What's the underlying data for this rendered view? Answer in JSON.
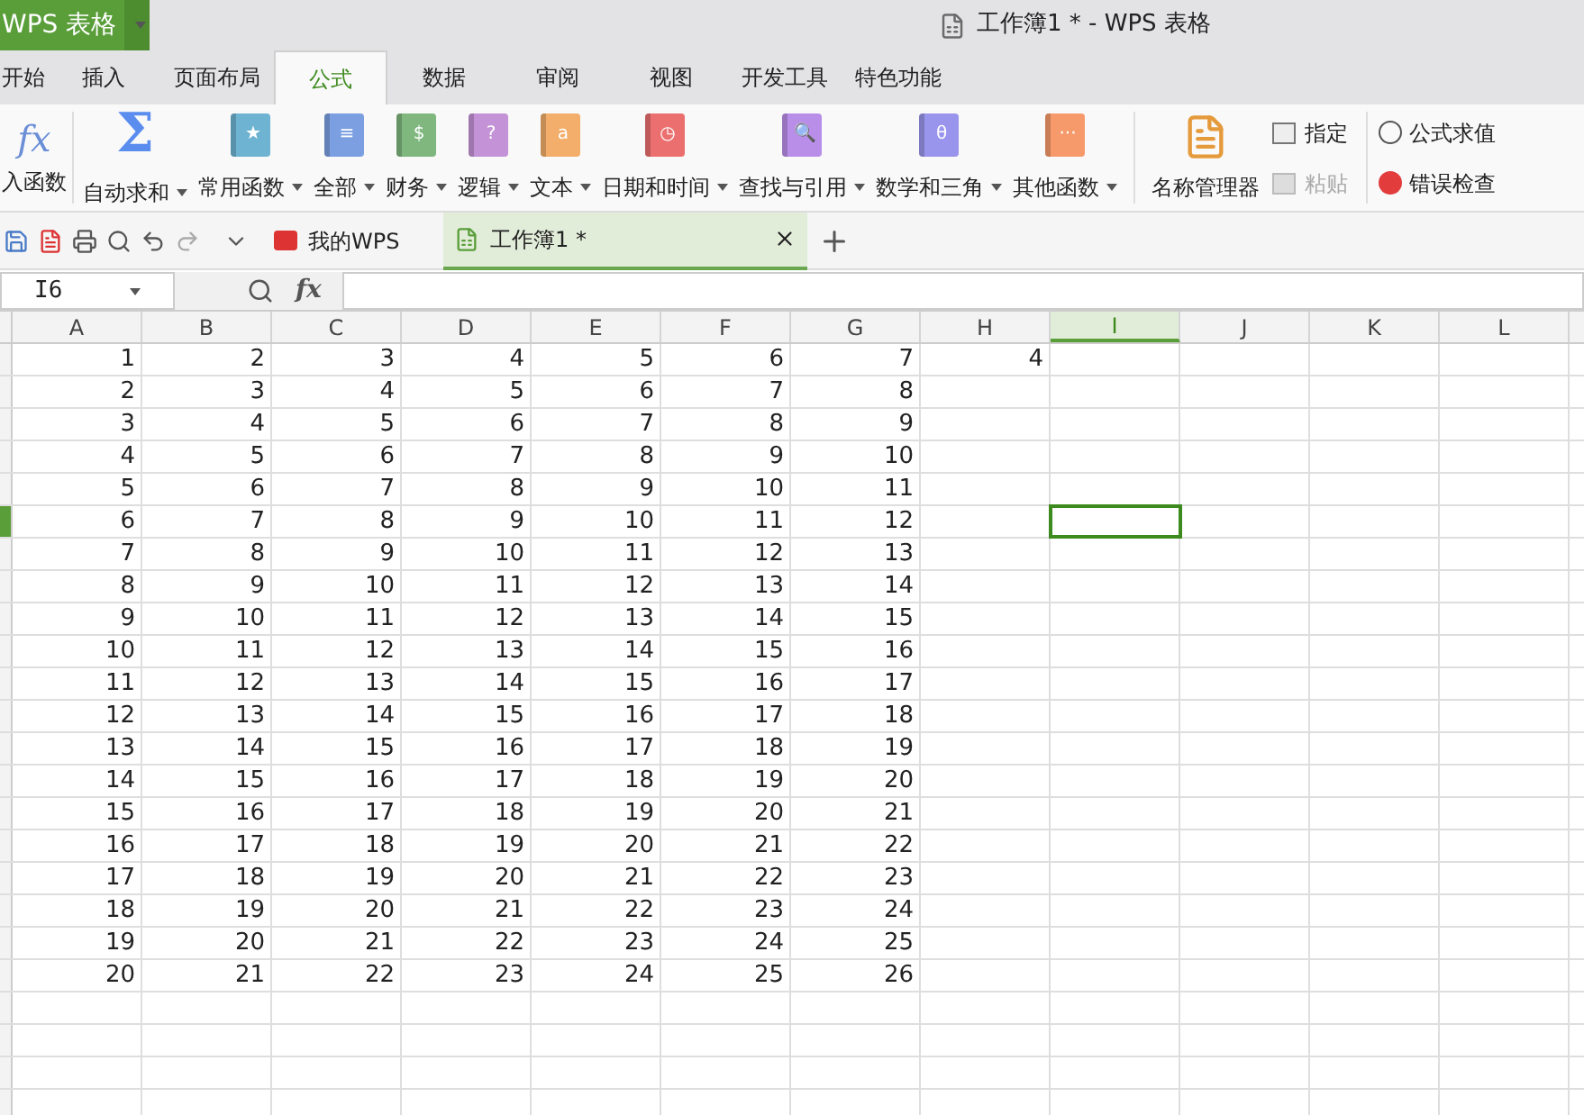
{
  "app_button": {
    "label": "WPS 表格"
  },
  "window": {
    "title": "工作簿1 * - WPS 表格"
  },
  "menu_tabs": [
    {
      "label": "开始",
      "selected": false
    },
    {
      "label": "插入",
      "selected": false
    },
    {
      "label": "页面布局",
      "selected": false
    },
    {
      "label": "公式",
      "selected": true
    },
    {
      "label": "数据",
      "selected": false
    },
    {
      "label": "审阅",
      "selected": false
    },
    {
      "label": "视图",
      "selected": false
    },
    {
      "label": "开发工具",
      "selected": false
    },
    {
      "label": "特色功能",
      "selected": false
    }
  ],
  "ribbon": {
    "insert_function": {
      "icon_text": "fx",
      "label": "入函数"
    },
    "function_groups": [
      {
        "label": "自动求和",
        "kind": "sigma",
        "color": "#5b8def",
        "glyph": "Σ"
      },
      {
        "label": "常用函数",
        "kind": "book",
        "color": "#6fb3d2",
        "glyph": "★"
      },
      {
        "label": "全部",
        "kind": "book",
        "color": "#7b9fe0",
        "glyph": "≡"
      },
      {
        "label": "财务",
        "kind": "book",
        "color": "#7fb77e",
        "glyph": "$"
      },
      {
        "label": "逻辑",
        "kind": "book",
        "color": "#c492d6",
        "glyph": "?"
      },
      {
        "label": "文本",
        "kind": "book",
        "color": "#f2ae6a",
        "glyph": "a"
      },
      {
        "label": "日期和时间",
        "kind": "book",
        "color": "#ec6f6f",
        "glyph": "◷"
      },
      {
        "label": "查找与引用",
        "kind": "book",
        "color": "#b98ee8",
        "glyph": "🔍"
      },
      {
        "label": "数学和三角",
        "kind": "book",
        "color": "#9a95ec",
        "glyph": "θ"
      },
      {
        "label": "其他函数",
        "kind": "book",
        "color": "#f79a6b",
        "glyph": "···"
      }
    ],
    "name_manager": {
      "label": "名称管理器"
    },
    "small_buttons": [
      {
        "label": "指定",
        "disabled": false
      },
      {
        "label": "粘贴",
        "disabled": true
      }
    ],
    "audit_buttons": [
      {
        "label": "公式求值"
      },
      {
        "label": "错误检查"
      }
    ]
  },
  "doc_tabs": [
    {
      "label": "我的WPS",
      "selected": false,
      "kind": "home"
    },
    {
      "label": "工作簿1 *",
      "selected": true,
      "kind": "sheet"
    }
  ],
  "formula_bar": {
    "name_box": "I6",
    "fx_label": "fx"
  },
  "sheet": {
    "columns": [
      {
        "label": "A",
        "selected": false
      },
      {
        "label": "B",
        "selected": false
      },
      {
        "label": "C",
        "selected": false
      },
      {
        "label": "D",
        "selected": false
      },
      {
        "label": "E",
        "selected": false
      },
      {
        "label": "F",
        "selected": false
      },
      {
        "label": "G",
        "selected": false
      },
      {
        "label": "H",
        "selected": false
      },
      {
        "label": "I",
        "selected": true
      },
      {
        "label": "J",
        "selected": false
      },
      {
        "label": "K",
        "selected": false
      },
      {
        "label": "L",
        "selected": false
      }
    ],
    "rows": [
      {
        "selected": false,
        "cells": [
          "1",
          "2",
          "3",
          "4",
          "5",
          "6",
          "7",
          "4"
        ]
      },
      {
        "selected": false,
        "cells": [
          "2",
          "3",
          "4",
          "5",
          "6",
          "7",
          "8"
        ]
      },
      {
        "selected": false,
        "cells": [
          "3",
          "4",
          "5",
          "6",
          "7",
          "8",
          "9"
        ]
      },
      {
        "selected": false,
        "cells": [
          "4",
          "5",
          "6",
          "7",
          "8",
          "9",
          "10"
        ]
      },
      {
        "selected": false,
        "cells": [
          "5",
          "6",
          "7",
          "8",
          "9",
          "10",
          "11"
        ]
      },
      {
        "selected": true,
        "cells": [
          "6",
          "7",
          "8",
          "9",
          "10",
          "11",
          "12"
        ]
      },
      {
        "selected": false,
        "cells": [
          "7",
          "8",
          "9",
          "10",
          "11",
          "12",
          "13"
        ]
      },
      {
        "selected": false,
        "cells": [
          "8",
          "9",
          "10",
          "11",
          "12",
          "13",
          "14"
        ]
      },
      {
        "selected": false,
        "cells": [
          "9",
          "10",
          "11",
          "12",
          "13",
          "14",
          "15"
        ]
      },
      {
        "selected": false,
        "cells": [
          "10",
          "11",
          "12",
          "13",
          "14",
          "15",
          "16"
        ]
      },
      {
        "selected": false,
        "cells": [
          "11",
          "12",
          "13",
          "14",
          "15",
          "16",
          "17"
        ]
      },
      {
        "selected": false,
        "cells": [
          "12",
          "13",
          "14",
          "15",
          "16",
          "17",
          "18"
        ]
      },
      {
        "selected": false,
        "cells": [
          "13",
          "14",
          "15",
          "16",
          "17",
          "18",
          "19"
        ]
      },
      {
        "selected": false,
        "cells": [
          "14",
          "15",
          "16",
          "17",
          "18",
          "19",
          "20"
        ]
      },
      {
        "selected": false,
        "cells": [
          "15",
          "16",
          "17",
          "18",
          "19",
          "20",
          "21"
        ]
      },
      {
        "selected": false,
        "cells": [
          "16",
          "17",
          "18",
          "19",
          "20",
          "21",
          "22"
        ]
      },
      {
        "selected": false,
        "cells": [
          "17",
          "18",
          "19",
          "20",
          "21",
          "22",
          "23"
        ]
      },
      {
        "selected": false,
        "cells": [
          "18",
          "19",
          "20",
          "21",
          "22",
          "23",
          "24"
        ]
      },
      {
        "selected": false,
        "cells": [
          "19",
          "20",
          "21",
          "22",
          "23",
          "24",
          "25"
        ]
      },
      {
        "selected": false,
        "cells": [
          "20",
          "21",
          "22",
          "23",
          "24",
          "25",
          "26"
        ]
      },
      {
        "selected": false
      },
      {
        "selected": false
      },
      {
        "selected": false
      },
      {
        "selected": false
      }
    ]
  }
}
